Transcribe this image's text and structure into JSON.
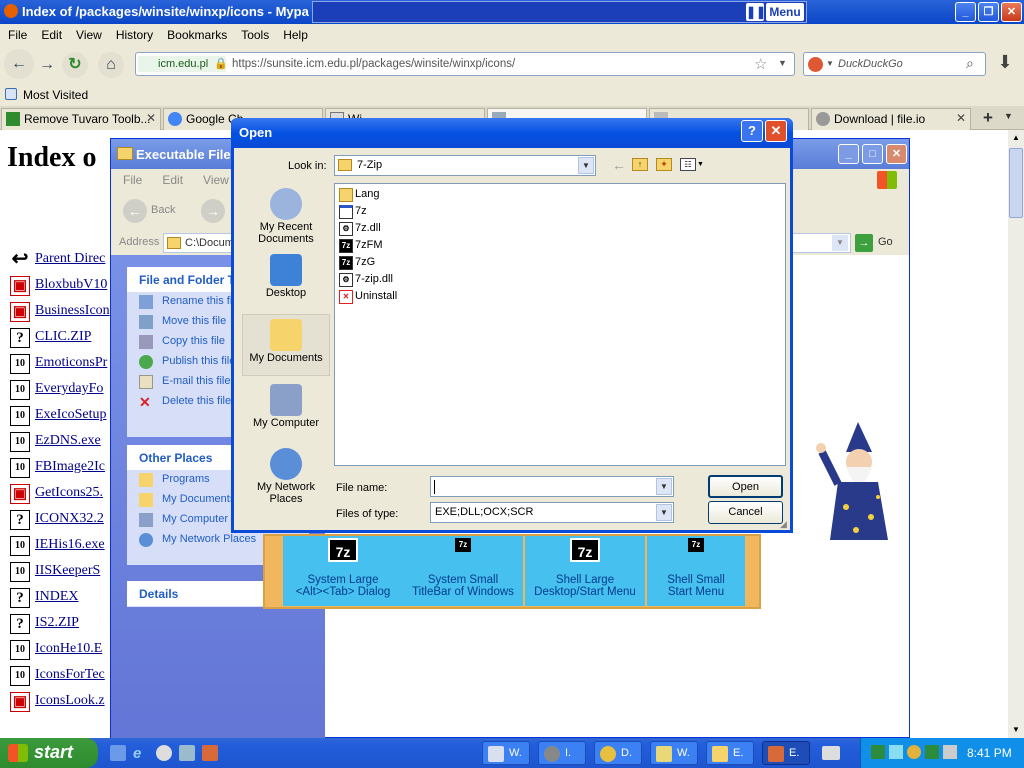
{
  "firefox": {
    "title": "Index of /packages/winsite/winxp/icons - Mypa",
    "menu": [
      "File",
      "Edit",
      "View",
      "History",
      "Bookmarks",
      "Tools",
      "Help"
    ],
    "url_site": "icm.edu.pl",
    "url": "https://sunsite.icm.edu.pl/packages/winsite/winxp/icons/",
    "search_placeholder": "DuckDuckGo",
    "overlay_menu": "Menu",
    "bookmark": "Most Visited",
    "tabs": [
      {
        "label": "Remove Tuvaro Toolb..."
      },
      {
        "label": "Google Ch..."
      },
      {
        "label": "Wi..."
      },
      {
        "label": "..."
      },
      {
        "label": "..."
      },
      {
        "label": "Download | file.io"
      }
    ]
  },
  "page": {
    "heading": "Index o",
    "entries": [
      {
        "name": "Parent Direc",
        "icon": "back"
      },
      {
        "name": "BloxbubV10",
        "icon": "exe"
      },
      {
        "name": "BusinessIcon",
        "icon": "exe"
      },
      {
        "name": "CLIC.ZIP",
        "icon": "unknown"
      },
      {
        "name": "EmoticonsPr",
        "icon": "binary"
      },
      {
        "name": "EverydayFo",
        "icon": "binary"
      },
      {
        "name": "ExeIcoSetup",
        "icon": "binary"
      },
      {
        "name": "EzDNS.exe",
        "icon": "binary"
      },
      {
        "name": "FBImage2Ic",
        "icon": "binary"
      },
      {
        "name": "GetIcons25.",
        "icon": "exe"
      },
      {
        "name": "ICONX32.2",
        "icon": "unknown"
      },
      {
        "name": "IEHis16.exe",
        "icon": "binary"
      },
      {
        "name": "IISKeeperS",
        "icon": "binary"
      },
      {
        "name": "INDEX",
        "icon": "unknown"
      },
      {
        "name": "IS2.ZIP",
        "icon": "unknown"
      },
      {
        "name": "IconHe10.E",
        "icon": "binary"
      },
      {
        "name": "IconsForTec",
        "icon": "binary"
      },
      {
        "name": "IconsLook.z",
        "icon": "exe"
      }
    ]
  },
  "explorer": {
    "title": "Executable File",
    "menu": [
      "File",
      "Edit",
      "View"
    ],
    "back": "Back",
    "address_label": "Address",
    "address_value": "C:\\Docum",
    "go": "Go",
    "tasks_header": "File and Folder T",
    "tasks": [
      "Rename this fi",
      "Move this file",
      "Copy this file",
      "Publish this file",
      "E-mail this file",
      "Delete this file"
    ],
    "other_header": "Other Places",
    "other": [
      "Programs",
      "My Documents",
      "My Computer",
      "My Network Places"
    ],
    "details_header": "Details",
    "icon_sizes": [
      {
        "label1": "System Large",
        "label2": "<Alt><Tab> Dialog"
      },
      {
        "label1": "System Small",
        "label2": "TitleBar of Windows"
      },
      {
        "label1": "Shell Large",
        "label2": "Desktop/Start Menu"
      },
      {
        "label1": "Shell Small",
        "label2": "Start Menu"
      }
    ]
  },
  "dialog": {
    "title": "Open",
    "lookin_label": "Look in:",
    "lookin_value": "7-Zip",
    "places": [
      "My Recent Documents",
      "Desktop",
      "My Documents",
      "My Computer",
      "My Network Places"
    ],
    "files": [
      {
        "name": "Lang",
        "type": "folder"
      },
      {
        "name": "7z",
        "type": "exe"
      },
      {
        "name": "7z.dll",
        "type": "dll"
      },
      {
        "name": "7zFM",
        "type": "7z"
      },
      {
        "name": "7zG",
        "type": "7z"
      },
      {
        "name": "7-zip.dll",
        "type": "dll"
      },
      {
        "name": "Uninstall",
        "type": "uninstall"
      }
    ],
    "filename_label": "File name:",
    "filename_value": "",
    "filetype_label": "Files of type:",
    "filetype_value": "EXE;DLL;OCX;SCR",
    "open": "Open",
    "cancel": "Cancel"
  },
  "taskbar": {
    "start": "start",
    "items": [
      "W.",
      "I.",
      "D.",
      "W.",
      "E.",
      "E."
    ],
    "clock": "8:41 PM"
  }
}
